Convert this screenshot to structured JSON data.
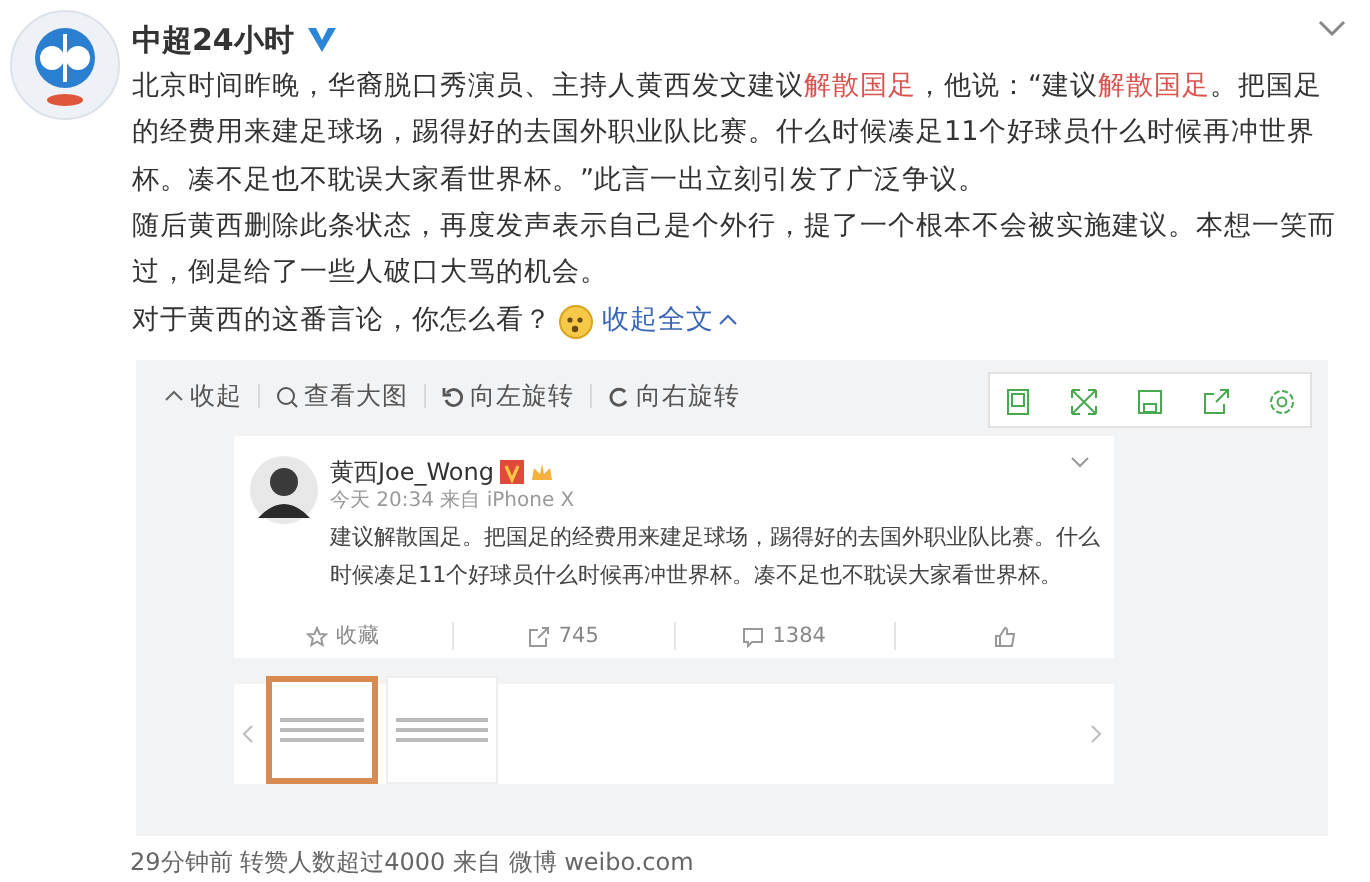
{
  "post": {
    "author": "中超24小时",
    "verified": true,
    "paragraphs": [
      [
        {
          "text": "北京时间昨晚，华裔脱口秀演员、主持人黄西发文建议",
          "highlight": false
        },
        {
          "text": "解散国足",
          "highlight": true
        },
        {
          "text": "，他说：“建议",
          "highlight": false
        },
        {
          "text": "解散国足",
          "highlight": true
        },
        {
          "text": "。把国足的经费用来建足球场，踢得好的去国外职业队比赛。什么时候凑足11个好球员什么时候再冲世界杯。凑不足也不耽误大家看世界杯。”此言一出立刻引发了广泛争议。",
          "highlight": false
        }
      ],
      [
        {
          "text": "随后黄西删除此条状态，再度发声表示自己是个外行，提了一个根本不会被实施建议。本想一笑而过，倒是给了一些人破口大骂的机会。",
          "highlight": false
        }
      ]
    ],
    "question": "对于黄西的这番言论，你怎么看？",
    "collapse_link": "收起全文",
    "footer": "29分钟前 转赞人数超过4000 来自 微博 weibo.com"
  },
  "viewer": {
    "toolbar": [
      {
        "label": "收起",
        "kind": "collapse"
      },
      {
        "label": "查看大图",
        "kind": "zoom"
      },
      {
        "label": "向左旋转",
        "kind": "rotate-left"
      },
      {
        "label": "向右旋转",
        "kind": "rotate-right"
      }
    ],
    "embedded_post": {
      "author": "黄西Joe_Wong",
      "meta": "今天 20:34 来自 iPhone X",
      "text": "建议解散国足。把国足的经费用来建足球场，踢得好的去国外职业队比赛。什么时候凑足11个好球员什么时候再冲世界杯。凑不足也不耽误大家看世界杯。",
      "actions": [
        {
          "kind": "favorite",
          "label": "收藏"
        },
        {
          "kind": "repost",
          "label": "745"
        },
        {
          "kind": "comment",
          "label": "1384"
        },
        {
          "kind": "like"
        }
      ]
    },
    "thumbnails": [
      {
        "selected": true
      },
      {
        "selected": false
      }
    ]
  }
}
